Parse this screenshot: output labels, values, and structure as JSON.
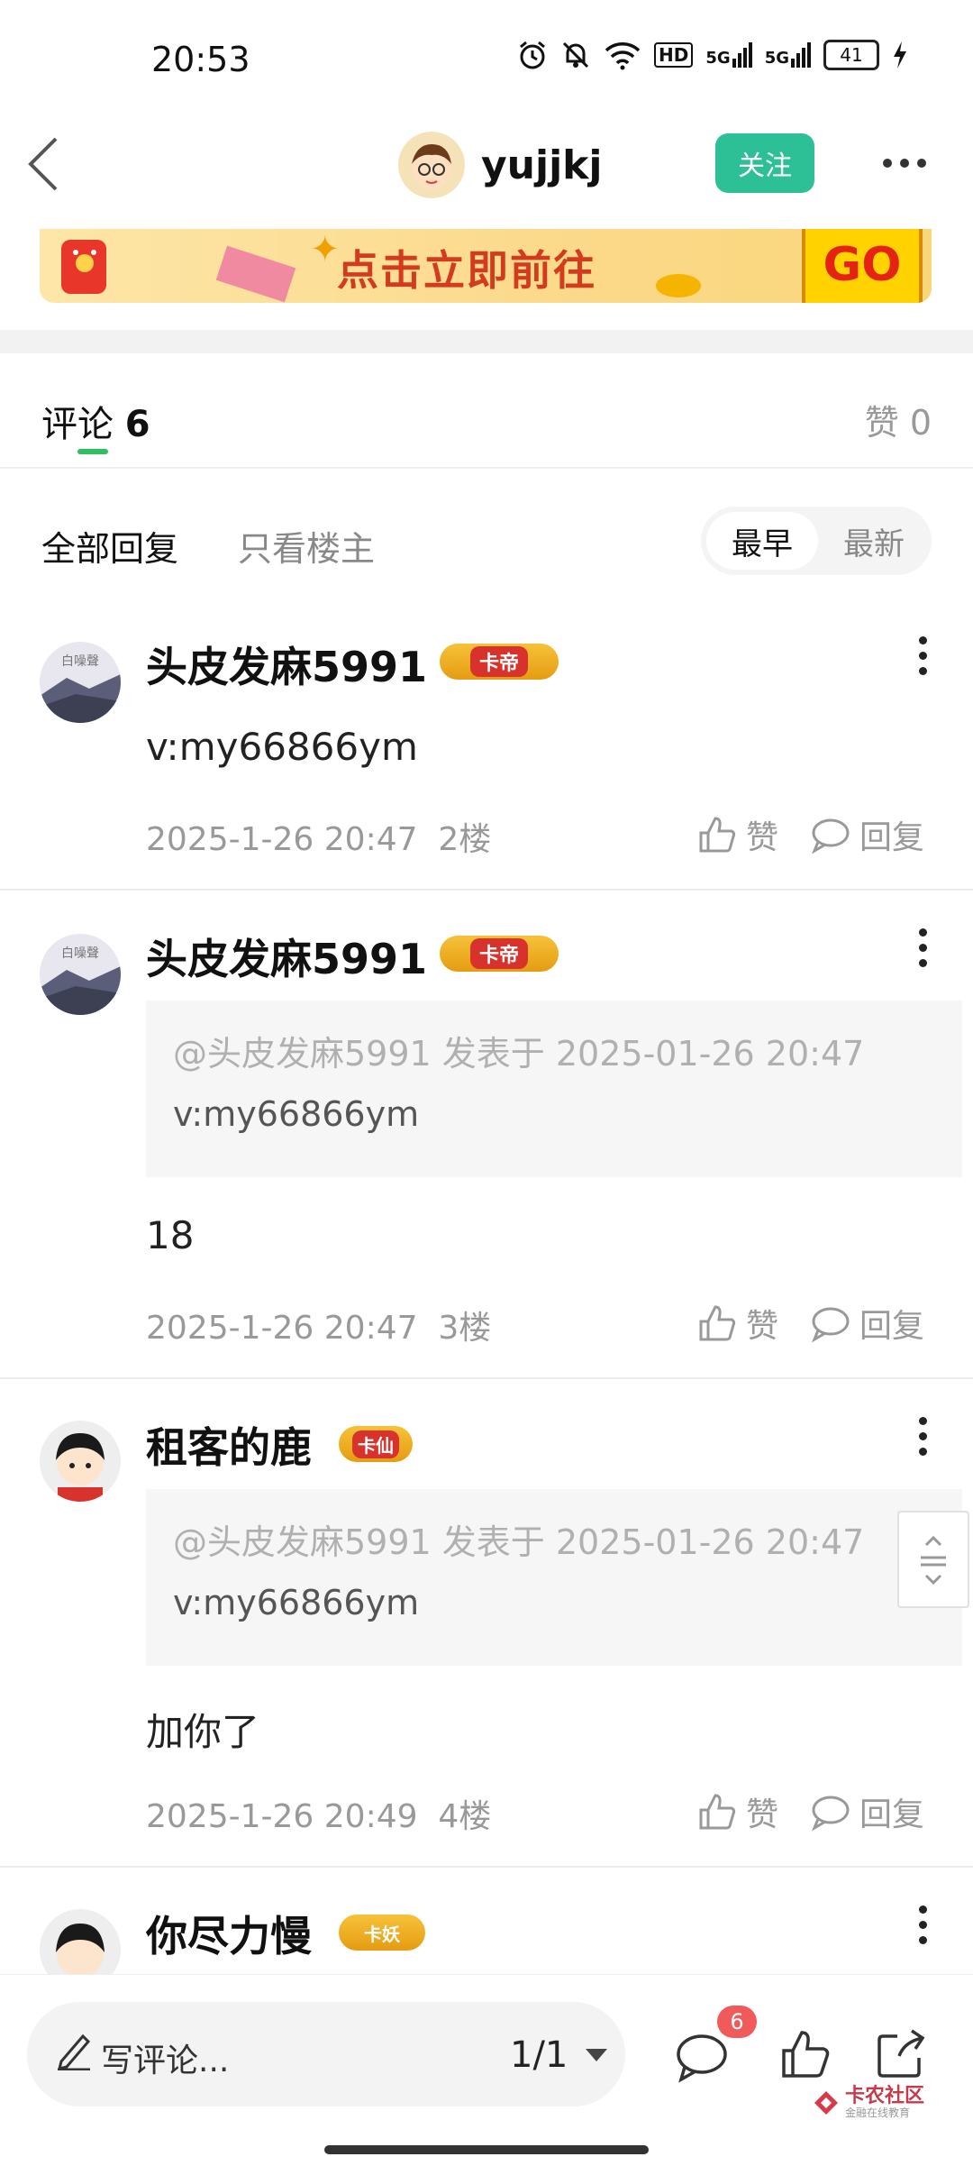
{
  "status_bar": {
    "time": "20:53",
    "network1": "5G",
    "network2": "5G",
    "hd": "HD",
    "battery": "41"
  },
  "header": {
    "author": "yujjkj",
    "follow": "关注"
  },
  "banner": {
    "text": "点击立即前往",
    "go": "GO"
  },
  "tabs": {
    "comments_label": "评论",
    "comments_count": "6",
    "likes": "赞 0"
  },
  "filter": {
    "all": "全部回复",
    "op_only": "只看楼主",
    "earliest": "最早",
    "newest": "最新"
  },
  "comments": [
    {
      "name": "头皮发麻5991",
      "badge": "卡帝",
      "text": "v:my66866ym",
      "date": "2025-1-26 20:47",
      "floor": "2楼",
      "like": "赞",
      "reply": "回复"
    },
    {
      "name": "头皮发麻5991",
      "badge": "卡帝",
      "quote_meta": "@头皮发麻5991 发表于 2025-01-26 20:47",
      "quote_text": "v:my66866ym",
      "text": "18",
      "date": "2025-1-26 20:47",
      "floor": "3楼",
      "like": "赞",
      "reply": "回复"
    },
    {
      "name": "租客的鹿",
      "badge": "卡仙",
      "quote_meta": "@头皮发麻5991 发表于 2025-01-26 20:47",
      "quote_text": "v:my66866ym",
      "text": "加你了",
      "date": "2025-1-26 20:49",
      "floor": "4楼",
      "like": "赞",
      "reply": "回复"
    },
    {
      "name": "你尽力慢",
      "badge": "卡妖"
    }
  ],
  "avatar_seal": "白噪聲",
  "bottom": {
    "write": "写评论...",
    "page": "1/1",
    "reply_count": "6"
  },
  "watermark": {
    "brand": "卡农社区",
    "slogan": "金融在线教育"
  },
  "colors": {
    "accent": "#2dbf95",
    "tab_underline": "#2dbf60",
    "badge_red": "#f05a5a"
  }
}
